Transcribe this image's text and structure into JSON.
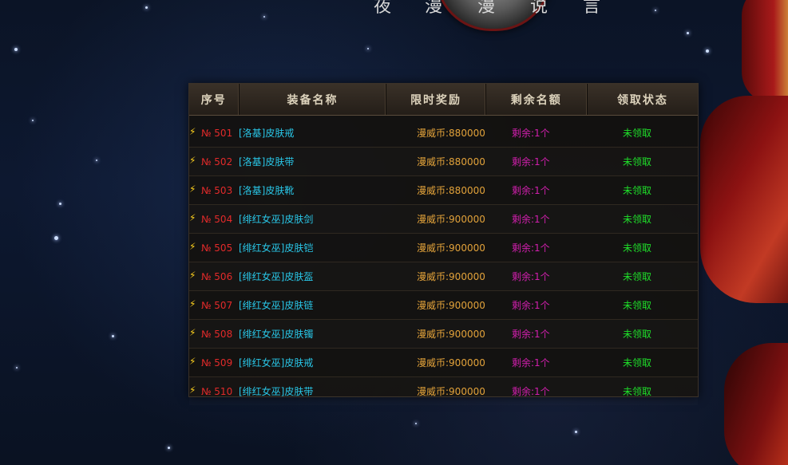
{
  "top_glyphs": [
    "夜",
    "漫",
    "漫",
    "说",
    "言"
  ],
  "table": {
    "headers": [
      "序号",
      "装备名称",
      "限时奖励",
      "剩余名额",
      "领取状态"
    ],
    "rows": [
      {
        "num": "№ 501",
        "name": "[洛基]皮肤戒",
        "reward": "漫威币:880000",
        "remain": "剩余:1个",
        "status": "未领取"
      },
      {
        "num": "№ 502",
        "name": "[洛基]皮肤带",
        "reward": "漫威币:880000",
        "remain": "剩余:1个",
        "status": "未领取"
      },
      {
        "num": "№ 503",
        "name": "[洛基]皮肤靴",
        "reward": "漫威币:880000",
        "remain": "剩余:1个",
        "status": "未领取"
      },
      {
        "num": "№ 504",
        "name": "[绯红女巫]皮肤剑",
        "reward": "漫威币:900000",
        "remain": "剩余:1个",
        "status": "未领取"
      },
      {
        "num": "№ 505",
        "name": "[绯红女巫]皮肤铠",
        "reward": "漫威币:900000",
        "remain": "剩余:1个",
        "status": "未领取"
      },
      {
        "num": "№ 506",
        "name": "[绯红女巫]皮肤盔",
        "reward": "漫威币:900000",
        "remain": "剩余:1个",
        "status": "未领取"
      },
      {
        "num": "№ 507",
        "name": "[绯红女巫]皮肤链",
        "reward": "漫威币:900000",
        "remain": "剩余:1个",
        "status": "未领取"
      },
      {
        "num": "№ 508",
        "name": "[绯红女巫]皮肤镯",
        "reward": "漫威币:900000",
        "remain": "剩余:1个",
        "status": "未领取"
      },
      {
        "num": "№ 509",
        "name": "[绯红女巫]皮肤戒",
        "reward": "漫威币:900000",
        "remain": "剩余:1个",
        "status": "未领取"
      },
      {
        "num": "№ 510",
        "name": "[绯红女巫]皮肤带",
        "reward": "漫威币:900000",
        "remain": "剩余:1个",
        "status": "未领取"
      }
    ]
  },
  "colors": {
    "number": "#e32a2a",
    "name": "#29c7e8",
    "reward": "#e2a23a",
    "remain": "#d21fae",
    "status": "#1fe02a",
    "bolt": "#ffd21e"
  },
  "icons": {
    "row_marker": "lightning-bolt-icon",
    "emblem": "shield-emblem"
  }
}
